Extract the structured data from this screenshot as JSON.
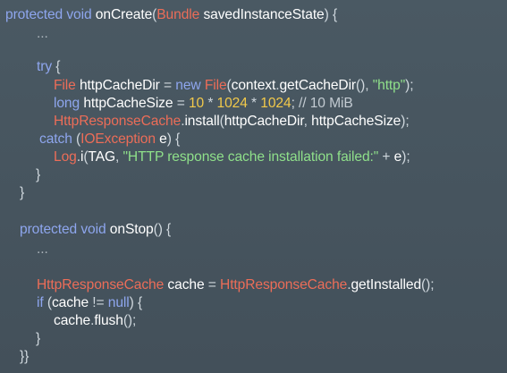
{
  "colors": {
    "background": "#47555f",
    "keyword": "#8ea6ee",
    "identifier": "#ffffff",
    "plain": "#cfd7dd",
    "class": "#ec6d58",
    "number": "#f2c94a",
    "string": "#8fe08a",
    "comment": "#c3cbd2"
  },
  "code": {
    "lines": [
      {
        "tokens": [
          {
            "t": "kw",
            "v": "protected void "
          },
          {
            "t": "id",
            "v": "onCreate"
          },
          {
            "t": "pu",
            "v": "("
          },
          {
            "t": "cl",
            "v": "Bundle"
          },
          {
            "t": "id",
            "v": " savedInstanceState"
          },
          {
            "t": "pu",
            "v": ") {"
          }
        ]
      },
      {
        "tokens": [
          {
            "t": "di",
            "v": "..."
          }
        ]
      },
      {
        "tokens": []
      },
      {
        "tokens": [
          {
            "t": "kw",
            "v": "try"
          },
          {
            "t": "pu",
            "v": " {"
          }
        ]
      },
      {
        "tokens": [
          {
            "t": "cl",
            "v": "File"
          },
          {
            "t": "id",
            "v": " httpCacheDir "
          },
          {
            "t": "pu",
            "v": "= "
          },
          {
            "t": "kw",
            "v": "new "
          },
          {
            "t": "cl",
            "v": "File"
          },
          {
            "t": "pu",
            "v": "("
          },
          {
            "t": "id",
            "v": "context"
          },
          {
            "t": "pu",
            "v": "."
          },
          {
            "t": "id",
            "v": "getCacheDir"
          },
          {
            "t": "pu",
            "v": "(), "
          },
          {
            "t": "st",
            "v": "\"http\""
          },
          {
            "t": "pu",
            "v": ");"
          }
        ]
      },
      {
        "tokens": [
          {
            "t": "kw",
            "v": "long"
          },
          {
            "t": "id",
            "v": " httpCacheSize "
          },
          {
            "t": "pu",
            "v": "= "
          },
          {
            "t": "nu",
            "v": "10"
          },
          {
            "t": "pu",
            "v": " * "
          },
          {
            "t": "nu",
            "v": "1024"
          },
          {
            "t": "pu",
            "v": " * "
          },
          {
            "t": "nu",
            "v": "1024"
          },
          {
            "t": "pu",
            "v": "; "
          },
          {
            "t": "cm",
            "v": "// 10 MiB"
          }
        ]
      },
      {
        "tokens": [
          {
            "t": "cl",
            "v": "HttpResponseCache"
          },
          {
            "t": "pu",
            "v": "."
          },
          {
            "t": "id",
            "v": "install"
          },
          {
            "t": "pu",
            "v": "("
          },
          {
            "t": "id",
            "v": "httpCacheDir"
          },
          {
            "t": "pu",
            "v": ", "
          },
          {
            "t": "id",
            "v": "httpCacheSize"
          },
          {
            "t": "pu",
            "v": ");"
          }
        ]
      },
      {
        "tokens": [
          {
            "t": "kw",
            "v": "catch"
          },
          {
            "t": "pu",
            "v": " ("
          },
          {
            "t": "cl",
            "v": "IOException"
          },
          {
            "t": "id",
            "v": " e"
          },
          {
            "t": "pu",
            "v": ") {"
          }
        ]
      },
      {
        "tokens": [
          {
            "t": "cl",
            "v": "Log"
          },
          {
            "t": "pu",
            "v": "."
          },
          {
            "t": "id",
            "v": "i"
          },
          {
            "t": "pu",
            "v": "("
          },
          {
            "t": "id",
            "v": "TAG"
          },
          {
            "t": "pu",
            "v": ", "
          },
          {
            "t": "st",
            "v": "\"HTTP response cache installation failed:\""
          },
          {
            "t": "pu",
            "v": " + "
          },
          {
            "t": "id",
            "v": "e"
          },
          {
            "t": "pu",
            "v": ");"
          }
        ]
      },
      {
        "tokens": [
          {
            "t": "pu",
            "v": "}"
          }
        ]
      },
      {
        "tokens": [
          {
            "t": "pu",
            "v": "}"
          }
        ]
      },
      {
        "tokens": []
      },
      {
        "tokens": [
          {
            "t": "kw",
            "v": "protected void "
          },
          {
            "t": "id",
            "v": "onStop"
          },
          {
            "t": "pu",
            "v": "() {"
          }
        ]
      },
      {
        "tokens": [
          {
            "t": "di",
            "v": "..."
          }
        ]
      },
      {
        "tokens": []
      },
      {
        "tokens": [
          {
            "t": "cl",
            "v": "HttpResponseCache"
          },
          {
            "t": "id",
            "v": " cache "
          },
          {
            "t": "pu",
            "v": "= "
          },
          {
            "t": "cl",
            "v": "HttpResponseCache"
          },
          {
            "t": "pu",
            "v": "."
          },
          {
            "t": "id",
            "v": "getInstalled"
          },
          {
            "t": "pu",
            "v": "();"
          }
        ]
      },
      {
        "tokens": [
          {
            "t": "kw",
            "v": "if"
          },
          {
            "t": "pu",
            "v": " ("
          },
          {
            "t": "id",
            "v": "cache "
          },
          {
            "t": "pu",
            "v": "!= "
          },
          {
            "t": "kw",
            "v": "null"
          },
          {
            "t": "pu",
            "v": ") {"
          }
        ]
      },
      {
        "tokens": [
          {
            "t": "id",
            "v": "cache"
          },
          {
            "t": "pu",
            "v": "."
          },
          {
            "t": "id",
            "v": "flush"
          },
          {
            "t": "pu",
            "v": "();"
          }
        ]
      },
      {
        "tokens": [
          {
            "t": "pu",
            "v": "}"
          }
        ]
      },
      {
        "tokens": [
          {
            "t": "pu",
            "v": "}}"
          }
        ]
      }
    ]
  }
}
